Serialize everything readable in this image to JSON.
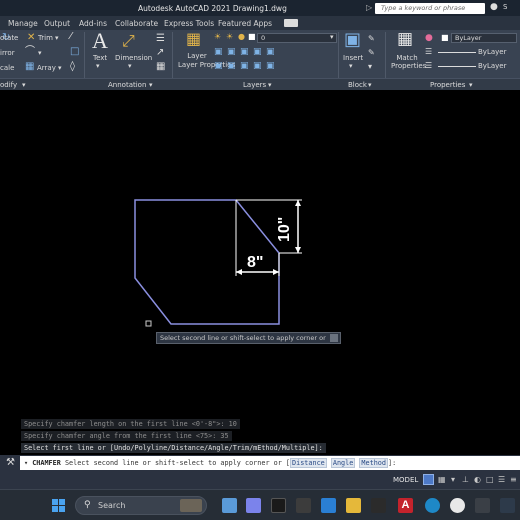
{
  "window": {
    "title": "Autodesk AutoCAD 2021    Drawing1.dwg",
    "search_placeholder": "Type a keyword or phrase"
  },
  "tabs": [
    "Manage",
    "Output",
    "Add-ins",
    "Collaborate",
    "Express Tools",
    "Featured Apps"
  ],
  "ribbon": {
    "modify": {
      "rotate": "otate",
      "trim": "Trim",
      "mirror": "irror",
      "scale": "cale",
      "array": "Array",
      "panel_label": "odify"
    },
    "annotation": {
      "text": "Text",
      "dimension": "Dimension",
      "panel_label": "Annotation"
    },
    "layers": {
      "layer_properties": "Layer Properties",
      "current_layer": "0",
      "panel_label": "Layers"
    },
    "block": {
      "insert": "Insert",
      "panel_label": "Block"
    },
    "properties": {
      "match_properties": "Match Properties",
      "color": "ByLayer",
      "linetype": "ByLayer",
      "lineweight": "ByLayer",
      "panel_label": "Properties"
    }
  },
  "drawing": {
    "dim_horizontal": "8\"",
    "dim_vertical": "10\"",
    "tooltip": "Select second line or shift-select to apply corner or"
  },
  "command_history": [
    "Specify chamfer length on the first line <0'-8\">: 10",
    "Specify chamfer angle from the first line <75>: 35",
    "Select first line or [Undo/Polyline/Distance/Angle/Trim/mEthod/Multiple]:"
  ],
  "command_line": {
    "command": "CHAMFER",
    "prompt": "Select second line or shift-select to apply corner or [",
    "options": [
      "Distance",
      "Angle",
      "Method"
    ],
    "suffix": "]:"
  },
  "status": {
    "mode": "MODEL"
  },
  "taskbar": {
    "search": "Search"
  },
  "colors": {
    "accent": "#4d79c7",
    "geometry": "#8a8fe0",
    "dimension": "#ffffff"
  }
}
